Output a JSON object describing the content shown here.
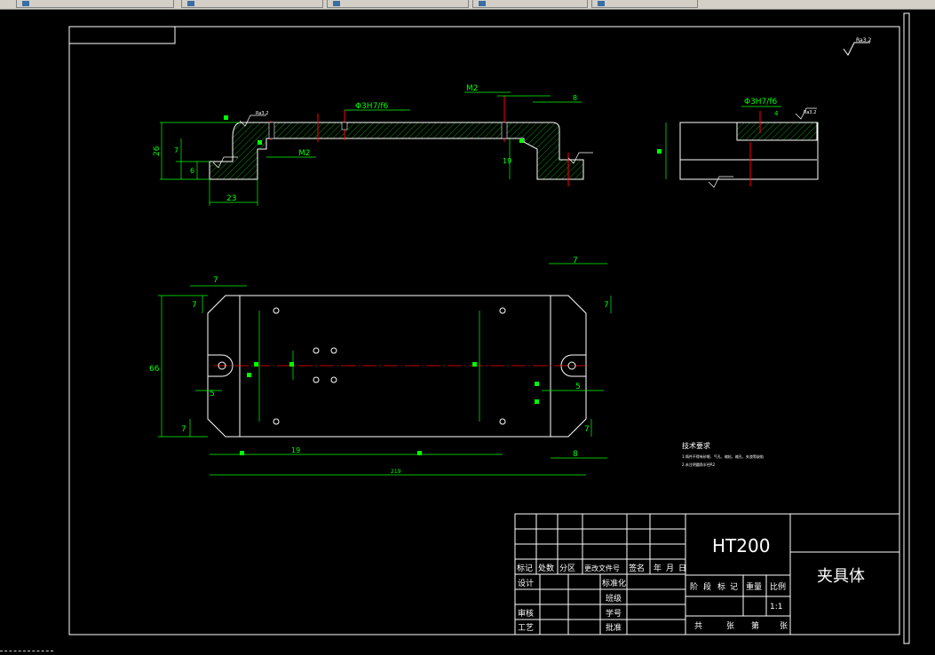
{
  "taskbar": {
    "buttons": [
      {
        "label": "",
        "icon": "window-icon"
      },
      {
        "label": "",
        "icon": "window-icon"
      },
      {
        "label": "",
        "icon": "window-icon"
      },
      {
        "label": "",
        "icon": "window-icon"
      },
      {
        "label": "",
        "icon": "window-icon"
      }
    ]
  },
  "drawing": {
    "colors": {
      "background": "#000000",
      "border": "#ffffff",
      "dim": "#00ff00",
      "center": "#ff0000",
      "part": "#ffffff"
    },
    "top_view_labels": {
      "fit1": "Φ3H7/f6",
      "m2_top": "M2",
      "m2_mid": "M2",
      "dim_8_top": "8",
      "dim_26": "26",
      "dim_7": "7",
      "dim_6": "6",
      "dim_23": "23",
      "dim_19": "19",
      "rough": "Ra3.2"
    },
    "side_view_labels": {
      "fit2": "Φ3H7/f6",
      "rough": "Ra3.2",
      "dim_4": "4"
    },
    "plan_labels": {
      "d7_tl": "7",
      "d7_tl2": "7",
      "d66": "66",
      "d5_l": "5",
      "d7_bl": "7",
      "d19": "19",
      "d7_tr": "7",
      "d7_tr2": "7",
      "d5_r": "5",
      "d7_br": "7",
      "d8_br": "8",
      "d_total": "219"
    },
    "tech_req": {
      "title": "技术要求",
      "line1": "1.铸件不得有砂眼、气孔、缩松、缩孔、夹渣等缺陷",
      "line2": "2.未注明圆角半径R2"
    },
    "title_block": {
      "material": "HT200",
      "part_name": "夹具体",
      "headers": [
        "标记",
        "处数",
        "分区",
        "更改文件号",
        "签名",
        "年",
        "月",
        "日"
      ],
      "left_rows": [
        "设计",
        "",
        "审核",
        "工艺"
      ],
      "mid_rows": [
        "标准化",
        "班级",
        "学号",
        "批准"
      ],
      "stage_row": [
        "阶",
        "段",
        "标",
        "记",
        "重量",
        "比例"
      ],
      "scale": "1:1",
      "sheet_row": [
        "共",
        "张",
        "第",
        "张"
      ]
    }
  }
}
